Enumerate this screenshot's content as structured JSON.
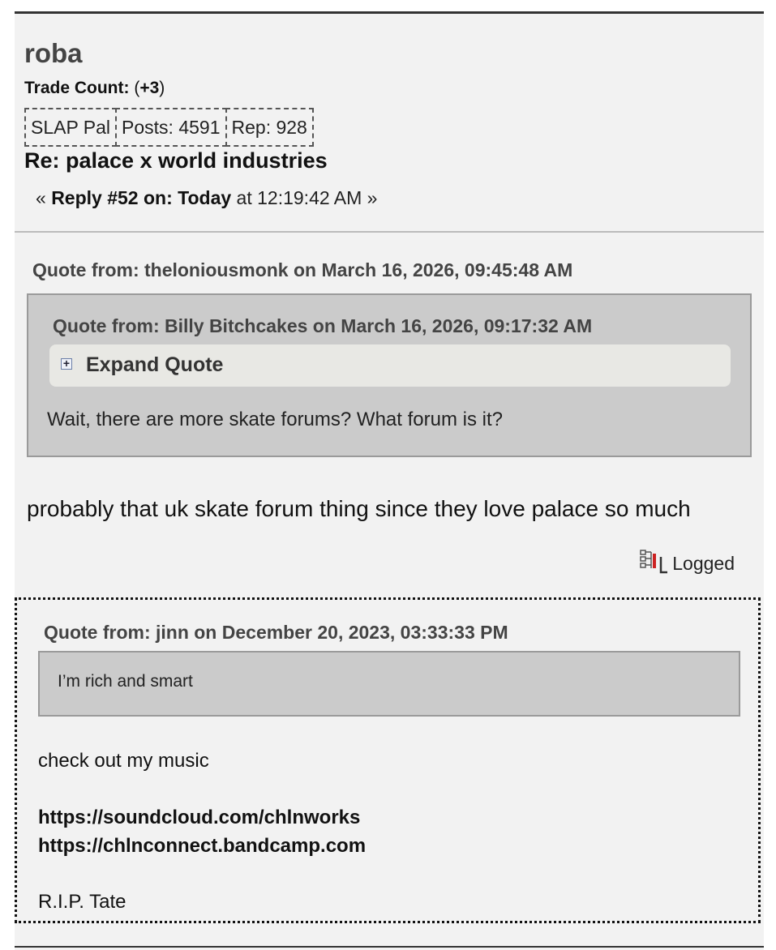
{
  "poster": {
    "name": "roba",
    "trade_label": "Trade Count:",
    "trade_open": "(",
    "trade_value": "+3",
    "trade_close": ")",
    "badges": [
      "SLAP Pal",
      "Posts: 4591",
      "Rep: 928"
    ]
  },
  "post": {
    "subject": "Re: palace x world industries",
    "reply_prefix": "« ",
    "reply_label": "Reply #52 on: Today",
    "reply_time": " at 12:19:42 AM »",
    "body": "probably that uk skate forum thing since they love palace so much",
    "logged_label": "Logged"
  },
  "outer_quote": {
    "header": "Quote from: theloniousmonk on March 16, 2026, 09:45:48 AM",
    "text": "Wait, there are more skate forums? What forum is it?"
  },
  "inner_quote": {
    "header": "Quote from: Billy Bitchcakes on March 16, 2026, 09:17:32 AM",
    "expand_label": "Expand Quote",
    "expand_icon": "plus-box-icon"
  },
  "signature": {
    "quote_header": "Quote from: jinn on December 20, 2023, 03:33:33 PM",
    "quote_text": "I’m rich and smart",
    "line1": "check out my music",
    "link1": "https://soundcloud.com/chlnworks",
    "link2": "https://chlnconnect.bandcamp.com",
    "line2": "R.I.P. Tate"
  },
  "colors": {
    "post_bg": "#f2f2f2",
    "quote_bg": "#cbcbcb",
    "expand_bg": "#e8e8e4",
    "header_text": "#444444"
  }
}
